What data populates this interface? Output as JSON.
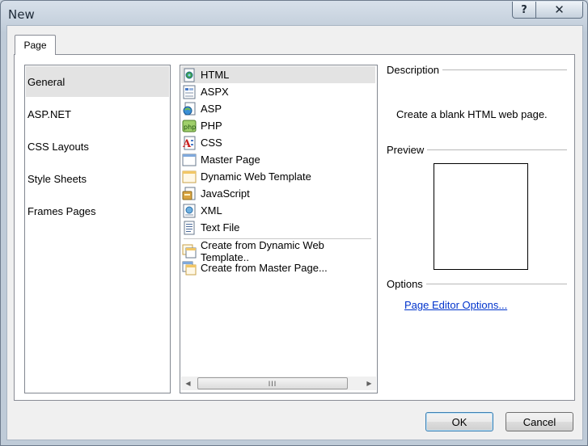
{
  "window": {
    "title": "New",
    "help_glyph": "?",
    "close_glyph": "✕"
  },
  "tab": {
    "label": "Page"
  },
  "categories": [
    {
      "label": "General",
      "selected": true
    },
    {
      "label": "ASP.NET",
      "selected": false
    },
    {
      "label": "CSS Layouts",
      "selected": false
    },
    {
      "label": "Style Sheets",
      "selected": false
    },
    {
      "label": "Frames Pages",
      "selected": false
    }
  ],
  "page_types": [
    {
      "label": "HTML",
      "icon": "html-file-icon",
      "selected": true
    },
    {
      "label": "ASPX",
      "icon": "aspx-file-icon"
    },
    {
      "label": "ASP",
      "icon": "asp-file-icon"
    },
    {
      "label": "PHP",
      "icon": "php-file-icon"
    },
    {
      "label": "CSS",
      "icon": "css-file-icon"
    },
    {
      "label": "Master Page",
      "icon": "master-page-icon"
    },
    {
      "label": "Dynamic Web Template",
      "icon": "dynamic-web-template-icon"
    },
    {
      "label": "JavaScript",
      "icon": "javascript-file-icon"
    },
    {
      "label": "XML",
      "icon": "xml-file-icon"
    },
    {
      "label": "Text File",
      "icon": "text-file-icon"
    }
  ],
  "create_from": [
    {
      "label": "Create from Dynamic Web Template..",
      "icon": "create-from-dwt-icon"
    },
    {
      "label": "Create from Master Page...",
      "icon": "create-from-master-icon"
    }
  ],
  "scrollbar": {
    "left_arrow": "◀",
    "right_arrow": "▶",
    "grip": "III"
  },
  "description": {
    "label": "Description",
    "text": "Create a blank HTML web page."
  },
  "preview": {
    "label": "Preview"
  },
  "options": {
    "label": "Options",
    "link": "Page Editor Options..."
  },
  "buttons": {
    "ok": "OK",
    "cancel": "Cancel"
  },
  "colors": {
    "selection": "#e3e3e3",
    "link": "#0033cc",
    "frame": "#bfcbd8"
  }
}
